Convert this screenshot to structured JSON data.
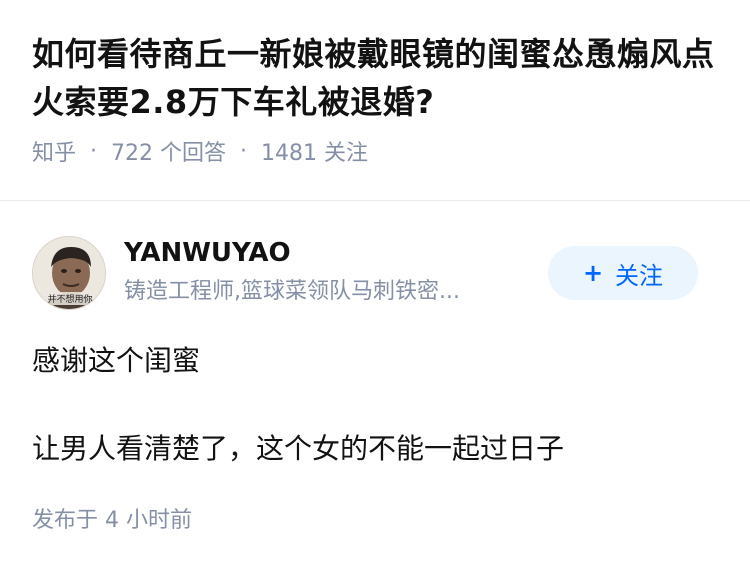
{
  "question": {
    "title": "如何看待商丘一新娘被戴眼镜的闺蜜怂恿煽风点火索要2.8万下车礼被退婚?",
    "source": "知乎",
    "answer_count": "722 个回答",
    "follow_count": "1481 关注"
  },
  "author": {
    "name": "YANWUYAO",
    "bio": "铸造工程师,篮球菜领队马刺铁密...",
    "avatar_caption": "并不想用你",
    "follow_label": "关注",
    "follow_icon": "plus-icon"
  },
  "answer": {
    "paragraphs": [
      "感谢这个闺蜜",
      "让男人看清楚了，这个女的不能一起过日子"
    ]
  },
  "published": "发布于 4 小时前",
  "colors": {
    "meta_gray": "#8590a6",
    "accent_blue": "#0066ff",
    "follow_bg": "#ebf5fd"
  }
}
